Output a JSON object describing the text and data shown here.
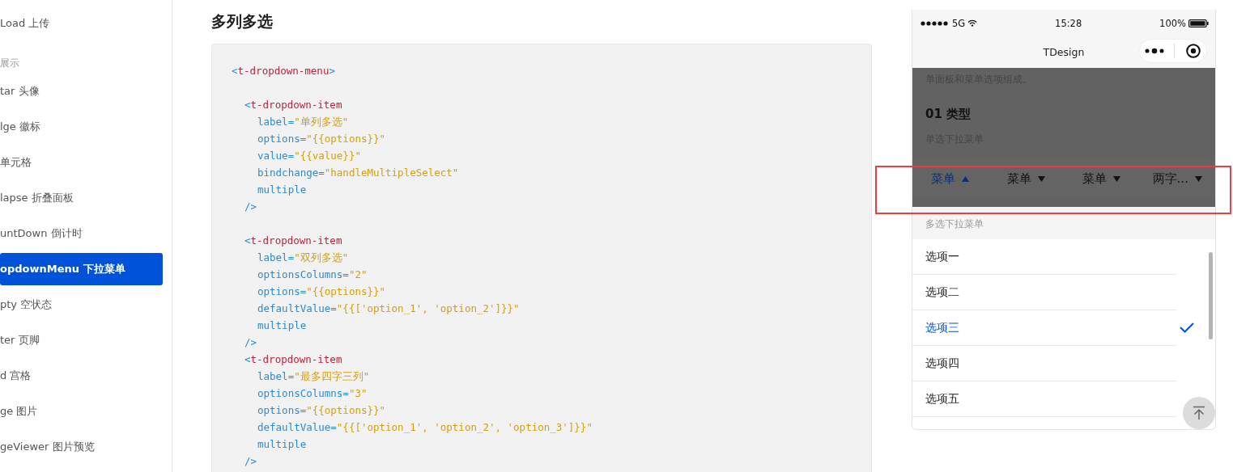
{
  "sidebar": {
    "items": [
      {
        "kind": "item",
        "label": "Load 上传",
        "selected": false
      },
      {
        "kind": "group",
        "label": "展示"
      },
      {
        "kind": "item",
        "label": "tar 头像",
        "selected": false
      },
      {
        "kind": "item",
        "label": "lge 徽标",
        "selected": false
      },
      {
        "kind": "item",
        "label": "单元格",
        "selected": false
      },
      {
        "kind": "item",
        "label": "lapse 折叠面板",
        "selected": false
      },
      {
        "kind": "item",
        "label": "untDown 倒计时",
        "selected": false
      },
      {
        "kind": "item",
        "label": "opdownMenu 下拉菜单",
        "selected": true
      },
      {
        "kind": "item",
        "label": "pty 空状态",
        "selected": false
      },
      {
        "kind": "item",
        "label": "ter 页脚",
        "selected": false
      },
      {
        "kind": "item",
        "label": "d 宫格",
        "selected": false
      },
      {
        "kind": "item",
        "label": "ge 图片",
        "selected": false
      },
      {
        "kind": "item",
        "label": "geViewer 图片预览",
        "selected": false
      }
    ]
  },
  "section": {
    "title": "多列多选",
    "code": [
      {
        "kind": "root",
        "tokens": [
          {
            "kind": "punct",
            "text": "<"
          },
          {
            "kind": "tag",
            "text": "t-dropdown-menu"
          },
          {
            "kind": "punct",
            "text": ">"
          }
        ]
      },
      {
        "kind": "blank"
      },
      {
        "kind": "element",
        "tokens": [
          {
            "kind": "punct",
            "text": "<"
          },
          {
            "kind": "tag",
            "text": "t-dropdown-item"
          }
        ]
      },
      {
        "kind": "attribute",
        "tokens": [
          {
            "kind": "attr",
            "text": "label="
          },
          {
            "kind": "string",
            "text": "\"单列多选\""
          }
        ]
      },
      {
        "kind": "attribute",
        "tokens": [
          {
            "kind": "attr",
            "text": "options="
          },
          {
            "kind": "string",
            "text": "\"{{options}}\""
          }
        ]
      },
      {
        "kind": "attribute",
        "tokens": [
          {
            "kind": "attr",
            "text": "value="
          },
          {
            "kind": "string",
            "text": "\"{{value}}\""
          }
        ]
      },
      {
        "kind": "attribute",
        "tokens": [
          {
            "kind": "attr",
            "text": "bindchange="
          },
          {
            "kind": "string",
            "text": "\"handleMultipleSelect\""
          }
        ]
      },
      {
        "kind": "attribute",
        "tokens": [
          {
            "kind": "attr",
            "text": "multiple"
          }
        ]
      },
      {
        "kind": "element",
        "tokens": [
          {
            "kind": "punct",
            "text": "/>"
          }
        ]
      },
      {
        "kind": "blank"
      },
      {
        "kind": "element",
        "tokens": [
          {
            "kind": "punct",
            "text": "<"
          },
          {
            "kind": "tag",
            "text": "t-dropdown-item"
          }
        ]
      },
      {
        "kind": "attribute",
        "tokens": [
          {
            "kind": "attr",
            "text": "label="
          },
          {
            "kind": "string",
            "text": "\"双列多选\""
          }
        ]
      },
      {
        "kind": "attribute",
        "tokens": [
          {
            "kind": "attr",
            "text": "optionsColumns="
          },
          {
            "kind": "string",
            "text": "\"2\""
          }
        ]
      },
      {
        "kind": "attribute",
        "tokens": [
          {
            "kind": "attr",
            "text": "options="
          },
          {
            "kind": "string",
            "text": "\"{{options}}\""
          }
        ]
      },
      {
        "kind": "attribute",
        "tokens": [
          {
            "kind": "attr",
            "text": "defaultValue="
          },
          {
            "kind": "string",
            "text": "\"{{['option_1', 'option_2']}}\""
          }
        ]
      },
      {
        "kind": "attribute",
        "tokens": [
          {
            "kind": "attr",
            "text": "multiple"
          }
        ]
      },
      {
        "kind": "element",
        "tokens": [
          {
            "kind": "punct",
            "text": "/>"
          }
        ]
      },
      {
        "kind": "element",
        "tokens": [
          {
            "kind": "punct",
            "text": "<"
          },
          {
            "kind": "tag",
            "text": "t-dropdown-item"
          }
        ]
      },
      {
        "kind": "attribute",
        "tokens": [
          {
            "kind": "attr",
            "text": "label="
          },
          {
            "kind": "string",
            "text": "\"最多四字三列\""
          }
        ]
      },
      {
        "kind": "attribute",
        "tokens": [
          {
            "kind": "attr",
            "text": "optionsColumns="
          },
          {
            "kind": "string",
            "text": "\"3\""
          }
        ]
      },
      {
        "kind": "attribute",
        "tokens": [
          {
            "kind": "attr",
            "text": "options="
          },
          {
            "kind": "string",
            "text": "\"{{options}}\""
          }
        ]
      },
      {
        "kind": "attribute",
        "tokens": [
          {
            "kind": "attr",
            "text": "defaultValue="
          },
          {
            "kind": "string",
            "text": "\"{{['option_1', 'option_2', 'option_3']}}\""
          }
        ]
      },
      {
        "kind": "attribute",
        "tokens": [
          {
            "kind": "attr",
            "text": "multiple"
          }
        ]
      },
      {
        "kind": "element",
        "tokens": [
          {
            "kind": "punct",
            "text": "/>"
          }
        ]
      }
    ]
  },
  "phone": {
    "status_bar": {
      "carrier": "5G",
      "time": "15:28",
      "battery": "100%"
    },
    "nav_title": "TDesign",
    "intro": "单面板和菜单选项组成。",
    "heading": "01 类型",
    "subheading": "单选下拉菜单",
    "menu": [
      {
        "label": "菜单",
        "selected": true
      },
      {
        "label": "菜单",
        "selected": false
      },
      {
        "label": "菜单",
        "selected": false
      },
      {
        "label": "两字...",
        "selected": false
      }
    ],
    "subheading_2": "多选下拉菜单",
    "options": [
      {
        "label": "选项一",
        "selected": false
      },
      {
        "label": "选项二",
        "selected": false
      },
      {
        "label": "选项三",
        "selected": true
      },
      {
        "label": "选项四",
        "selected": false
      },
      {
        "label": "选项五",
        "selected": false
      }
    ]
  }
}
